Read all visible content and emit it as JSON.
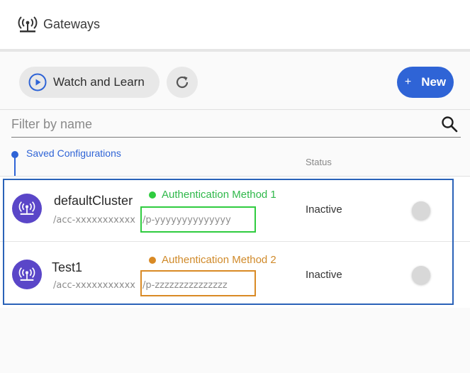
{
  "header": {
    "title": "Gateways",
    "icon": "antenna-icon"
  },
  "toolbar": {
    "watch_label": "Watch and Learn",
    "new_plus": "+",
    "new_label": "New"
  },
  "filter": {
    "placeholder": "Filter by name"
  },
  "list": {
    "section_label": "Saved Configurations",
    "status_header": "Status",
    "rows": [
      {
        "name": "defaultCluster",
        "acc": "/acc-xxxxxxxxxxx",
        "p": "/p-yyyyyyyyyyyyyy",
        "status": "Inactive"
      },
      {
        "name": "Test1",
        "acc": "/acc-xxxxxxxxxxx",
        "p": "/p-zzzzzzzzzzzzzzz",
        "status": "Inactive"
      }
    ]
  },
  "annotations": {
    "auth1": "Authentication Method 1",
    "auth2": "Authentication Method 2"
  },
  "colors": {
    "accent": "#2f64d6",
    "avatar": "#5a46c8",
    "auth1": "#2fcc3f",
    "auth2": "#d98a25",
    "highlight": "#2a62b8"
  }
}
